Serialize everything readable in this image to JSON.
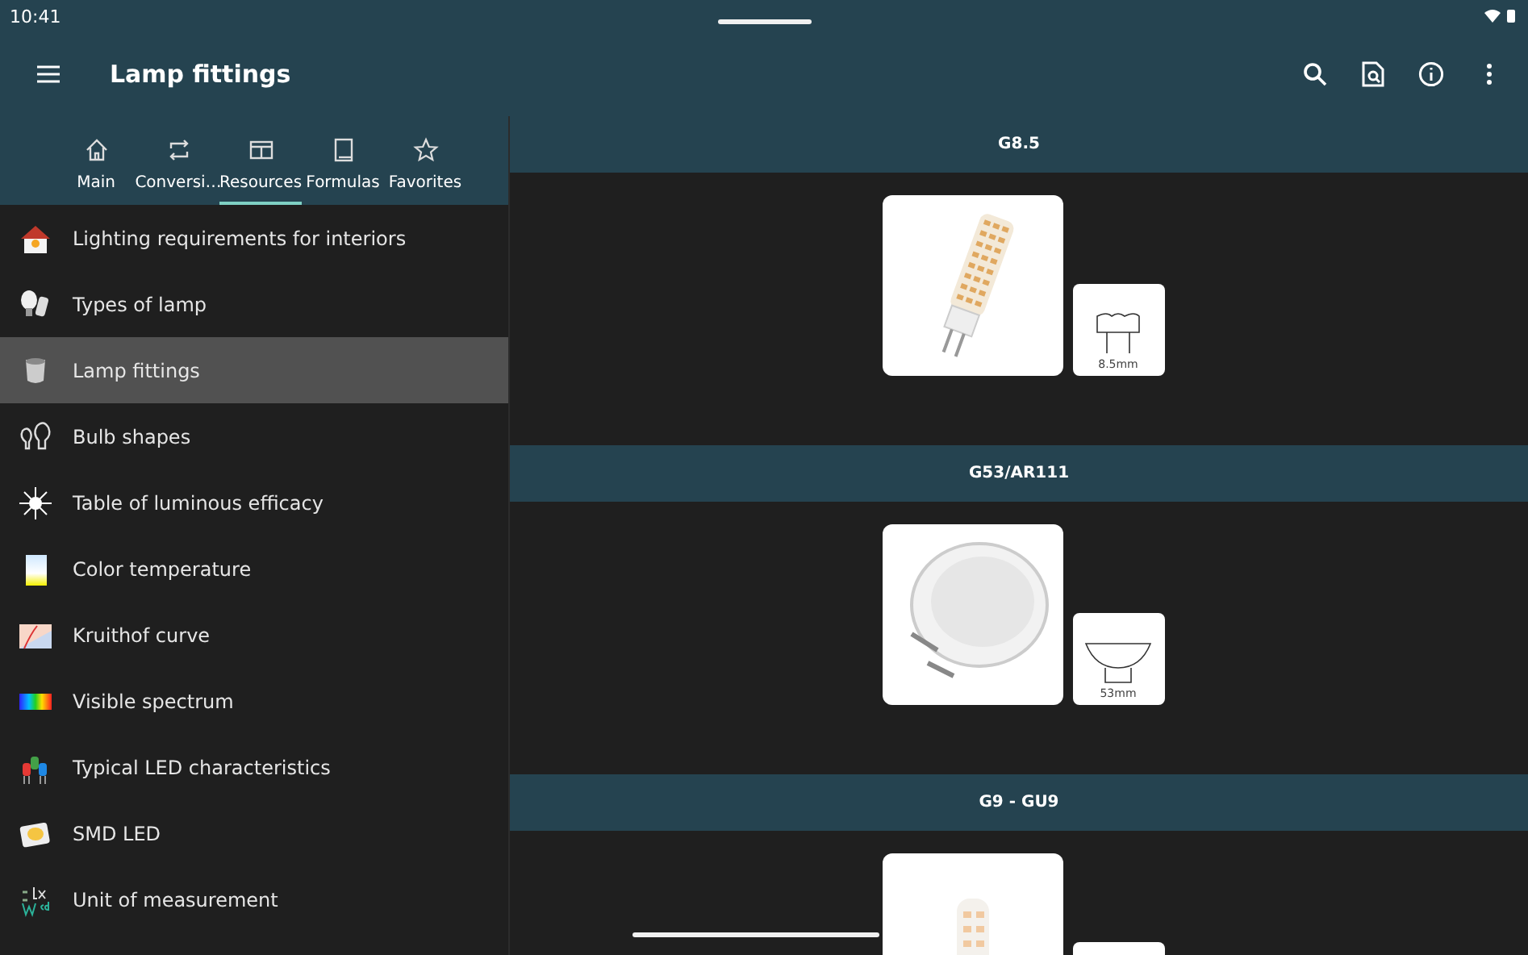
{
  "status_bar": {
    "time": "10:41"
  },
  "app_bar": {
    "title": "Lamp fittings"
  },
  "tabs": [
    {
      "label": "Main",
      "selected": false
    },
    {
      "label": "Conversi…",
      "selected": false
    },
    {
      "label": "Resources",
      "selected": true
    },
    {
      "label": "Formulas",
      "selected": false
    },
    {
      "label": "Favorites",
      "selected": false
    }
  ],
  "sidebar": {
    "items": [
      {
        "label": "Lighting requirements for interiors",
        "selected": false
      },
      {
        "label": "Types of lamp",
        "selected": false
      },
      {
        "label": "Lamp fittings",
        "selected": true
      },
      {
        "label": "Bulb shapes",
        "selected": false
      },
      {
        "label": "Table of luminous efficacy",
        "selected": false
      },
      {
        "label": "Color temperature",
        "selected": false
      },
      {
        "label": "Kruithof curve",
        "selected": false
      },
      {
        "label": "Visible spectrum",
        "selected": false
      },
      {
        "label": "Typical LED characteristics",
        "selected": false
      },
      {
        "label": "SMD LED",
        "selected": false
      },
      {
        "label": "Unit of measurement",
        "selected": false
      }
    ]
  },
  "sections": [
    {
      "title": "G8.5",
      "dimension": "8.5mm",
      "kind": "pin"
    },
    {
      "title": "G53/AR111",
      "dimension": "53mm",
      "kind": "reflector"
    },
    {
      "title": "G9 - GU9",
      "kind": "pin"
    }
  ]
}
